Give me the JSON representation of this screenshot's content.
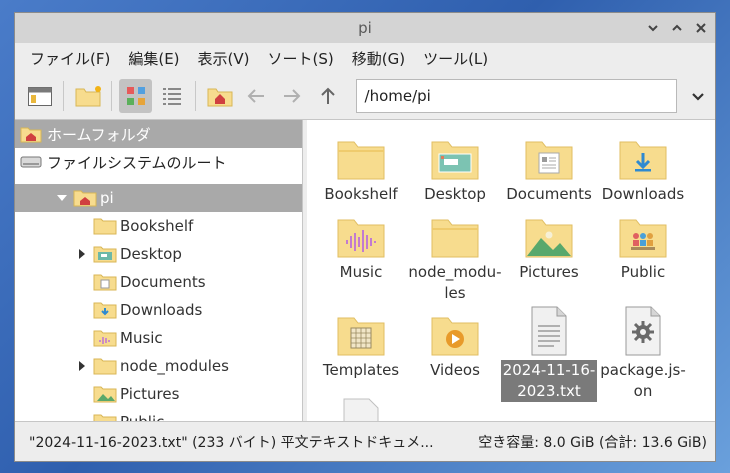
{
  "window": {
    "title": "pi"
  },
  "menu": [
    "ファイル(F)",
    "編集(E)",
    "表示(V)",
    "ソート(S)",
    "移動(G)",
    "ツール(L)"
  ],
  "toolbar": {
    "path": "/home/pi"
  },
  "sidebar": {
    "places": [
      {
        "label": "ホームフォルダ",
        "icon": "home-folder-icon"
      },
      {
        "label": "ファイルシステムのルート",
        "icon": "drive-icon"
      }
    ],
    "tree": [
      {
        "label": "pi",
        "expanded": true
      },
      {
        "label": "Bookshelf"
      },
      {
        "label": "Desktop"
      },
      {
        "label": "Documents"
      },
      {
        "label": "Downloads"
      },
      {
        "label": "Music"
      },
      {
        "label": "node_modules"
      },
      {
        "label": "Pictures"
      },
      {
        "label": "Public"
      }
    ]
  },
  "files": [
    {
      "name": "Bookshelf",
      "kind": "folder"
    },
    {
      "name": "Desktop",
      "kind": "folder-desktop"
    },
    {
      "name": "Documents",
      "kind": "folder-documents"
    },
    {
      "name": "Downloads",
      "kind": "folder-downloads"
    },
    {
      "name": "Music",
      "kind": "folder-music"
    },
    {
      "name": "node_modules",
      "display": "node_modu-\nles",
      "kind": "folder"
    },
    {
      "name": "Pictures",
      "kind": "folder-pictures"
    },
    {
      "name": "Public",
      "kind": "folder-public"
    },
    {
      "name": "Templates",
      "kind": "folder-templates"
    },
    {
      "name": "Videos",
      "kind": "folder-videos"
    },
    {
      "name": "2024-11-16-2023.txt",
      "display": "2024-11-16-\n2023.txt",
      "kind": "text-file",
      "selected": true
    },
    {
      "name": "package.json",
      "display": "package.js-\non",
      "kind": "json-file"
    }
  ],
  "status": {
    "left": "\"2024-11-16-2023.txt\" (233 バイト) 平文テキストドキュメ...",
    "right": "空き容量: 8.0 GiB (合計: 13.6 GiB)"
  },
  "colors": {
    "folder": "#f7dc8e",
    "folder_tab": "#efcb6d",
    "selection": "#a9a9a9"
  }
}
